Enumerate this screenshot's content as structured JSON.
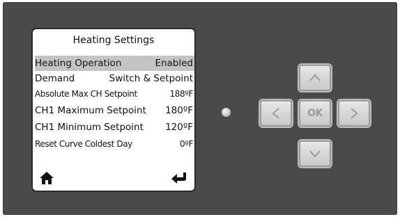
{
  "screen": {
    "title": "Heating Settings",
    "rows": [
      {
        "label": "Heating Operation",
        "value": "Enabled",
        "selected": true
      },
      {
        "label": "Demand",
        "value": "Switch & Setpoint",
        "selected": false
      },
      {
        "label": "Absolute Max CH Setpoint",
        "value": "188ºF",
        "selected": false
      },
      {
        "label": "CH1 Maximum Setpoint",
        "value": "180ºF",
        "selected": false
      },
      {
        "label": "CH1 Minimum Setpoint",
        "value": "120ºF",
        "selected": false
      },
      {
        "label": "Reset Curve Coldest Day",
        "value": "0ºF",
        "selected": false
      }
    ],
    "footer_icons": [
      "home-icon",
      "return-icon"
    ]
  },
  "keypad": {
    "ok_label": "OK",
    "icons": [
      "chevron-up-icon",
      "chevron-left-icon",
      "chevron-right-icon",
      "chevron-down-icon"
    ]
  },
  "colors": {
    "panel": "#4a4a4a",
    "lcd_background": "#ffffff",
    "selected_row": "#c4c4c4",
    "button_face": "#d6d6d6"
  }
}
